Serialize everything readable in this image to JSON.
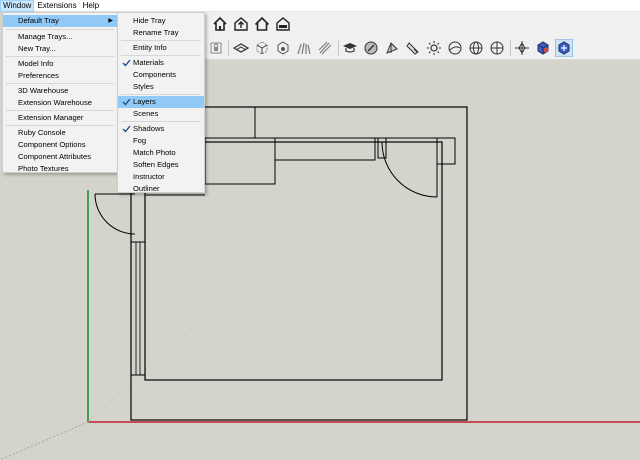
{
  "menubar": {
    "items": [
      {
        "label": "Window",
        "active": true
      },
      {
        "label": "Extensions",
        "active": false
      },
      {
        "label": "Help",
        "active": false
      }
    ]
  },
  "window_menu": {
    "items": [
      {
        "label": "Default Tray",
        "submenu": true,
        "highlighted": true
      },
      {
        "label": "Manage Trays..."
      },
      {
        "label": "New Tray..."
      },
      {
        "label": "Model Info"
      },
      {
        "label": "Preferences"
      },
      {
        "label": "3D Warehouse"
      },
      {
        "label": "Extension Warehouse"
      },
      {
        "label": "Extension Manager"
      },
      {
        "label": "Ruby Console"
      },
      {
        "label": "Component Options"
      },
      {
        "label": "Component Attributes"
      },
      {
        "label": "Photo Textures"
      }
    ]
  },
  "tray_menu": {
    "items": [
      {
        "label": "Hide Tray",
        "checked": false,
        "highlighted": false
      },
      {
        "label": "Rename Tray",
        "checked": false,
        "highlighted": false
      },
      {
        "label": "Entity Info",
        "checked": false,
        "highlighted": false
      },
      {
        "label": "Materials",
        "checked": true,
        "highlighted": false
      },
      {
        "label": "Components",
        "checked": false,
        "highlighted": false
      },
      {
        "label": "Styles",
        "checked": false,
        "highlighted": false
      },
      {
        "label": "Layers",
        "checked": true,
        "highlighted": true
      },
      {
        "label": "Scenes",
        "checked": false,
        "highlighted": false
      },
      {
        "label": "Shadows",
        "checked": true,
        "highlighted": false
      },
      {
        "label": "Fog",
        "checked": false,
        "highlighted": false
      },
      {
        "label": "Match Photo",
        "checked": false,
        "highlighted": false
      },
      {
        "label": "Soften Edges",
        "checked": false,
        "highlighted": false
      },
      {
        "label": "Instructor",
        "checked": false,
        "highlighted": false
      },
      {
        "label": "Outliner",
        "checked": false,
        "highlighted": false
      }
    ]
  },
  "toolbar": {
    "row1_icons": [
      "home-view-icon",
      "warehouse-upload-icon",
      "home-outline-icon",
      "warehouse-share-icon"
    ],
    "row2_icons": [
      "lock-icon",
      "xray-icon",
      "back-edges-icon",
      "section-icon",
      "hidden-geometry-icon",
      "sketchy-edges-icon",
      "graduate-icon",
      "shaded-textures-icon",
      "monochrome-icon",
      "paint-bucket-icon",
      "sun-icon",
      "fog-globe-icon",
      "wireframe-globe-icon",
      "axes-globe-icon",
      "orbit-icon",
      "component-icon",
      "extension-icon"
    ]
  },
  "colors": {
    "menu_highlight": "#91c9f7",
    "canvas_bg": "#d4d4cc",
    "axis_green": "#1a8a2a",
    "axis_red": "#c0202a"
  }
}
